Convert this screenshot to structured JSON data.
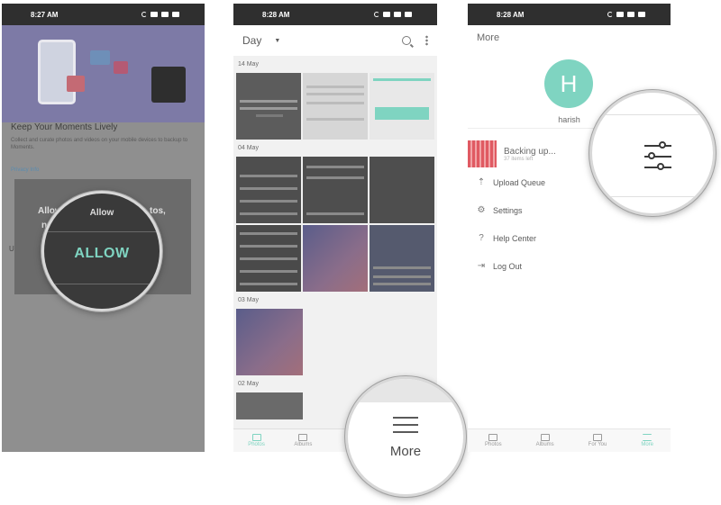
{
  "phone1": {
    "time": "8:27 AM",
    "title": "Keep Your Moments Lively",
    "desc": "Collect and curate photos and videos on your mobile devices to backup to Moments.",
    "link": "Privacy Info",
    "dialog_line1": "Allow",
    "dialog_line1_suffix": "tos,",
    "dialog_line2": "n",
    "side_label": "U",
    "magnifier": {
      "text1": "Allow",
      "text2": "",
      "button": "ALLOW"
    }
  },
  "phone2": {
    "time": "8:28 AM",
    "view_mode": "Day",
    "sections": [
      {
        "date": "14 May"
      },
      {
        "date": "04 May"
      },
      {
        "date": "03 May"
      },
      {
        "date": "02 May"
      }
    ],
    "bottom_nav": [
      "Photos",
      "Albums"
    ],
    "magnifier": {
      "label": "More"
    }
  },
  "phone3": {
    "time": "8:28 AM",
    "header": "More",
    "avatar_letter": "H",
    "username": "harish",
    "backup_title": "Backing up...",
    "backup_sub": "37 items left",
    "menu": [
      {
        "icon": "upload-icon",
        "label": "Upload Queue"
      },
      {
        "icon": "gear-icon",
        "label": "Settings"
      },
      {
        "icon": "help-icon",
        "label": "Help Center"
      },
      {
        "icon": "logout-icon",
        "label": "Log Out"
      }
    ],
    "bottom_nav": [
      "Photos",
      "Albums",
      "For You",
      "More"
    ]
  },
  "colors": {
    "accent": "#7fd4c1",
    "statusbar": "#2f2f2f",
    "hero": "#7d7aa6"
  }
}
